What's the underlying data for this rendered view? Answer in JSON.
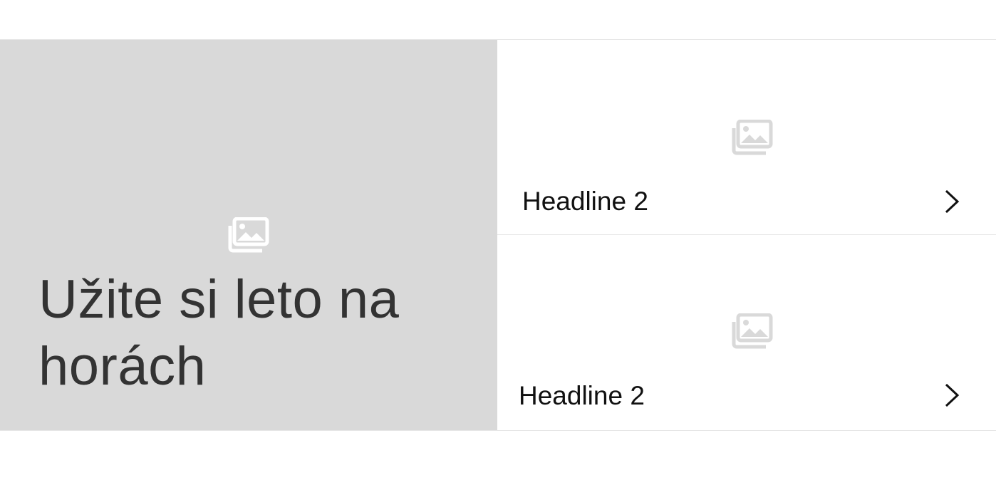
{
  "hero": {
    "title": "Užite si leto na horách",
    "image_icon": "image-gallery-icon",
    "background_color": "#d9d9d9",
    "text_color": "#333333"
  },
  "cards": [
    {
      "headline": "Headline 2",
      "image_icon": "image-gallery-icon",
      "action_icon": "chevron-right-icon"
    },
    {
      "headline": "Headline 2",
      "image_icon": "image-gallery-icon",
      "action_icon": "chevron-right-icon"
    }
  ],
  "colors": {
    "divider": "#e6e6e6",
    "placeholder_icon_on_gray": "#ffffff",
    "placeholder_icon_on_white": "#d9d9d9",
    "headline": "#111111"
  }
}
